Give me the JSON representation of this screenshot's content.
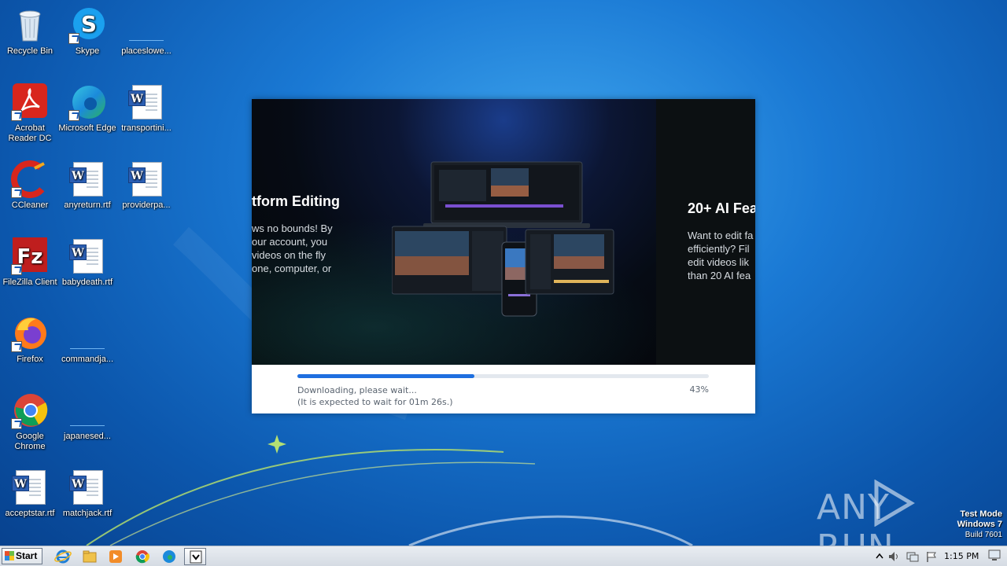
{
  "desktop": {
    "icons": [
      {
        "label": "Recycle Bin"
      },
      {
        "label": "Skype"
      },
      {
        "label": "placeslowe..."
      },
      {
        "label": "Acrobat\nReader DC"
      },
      {
        "label": "Microsoft Edge"
      },
      {
        "label": "transportini..."
      },
      {
        "label": "CCleaner"
      },
      {
        "label": "anyreturn.rtf"
      },
      {
        "label": "providerpa..."
      },
      {
        "label": "FileZilla Client"
      },
      {
        "label": "babydeath.rtf"
      },
      {
        "label": "Firefox"
      },
      {
        "label": "commandja..."
      },
      {
        "label": "Google\nChrome"
      },
      {
        "label": "japanesed..."
      },
      {
        "label": "acceptstar.rtf"
      },
      {
        "label": "matchjack.rtf"
      }
    ]
  },
  "installer": {
    "banner": {
      "left_title": "tform Editing",
      "left_text": "ws no bounds! By\nour account, you\nvideos on the fly\none, computer, or",
      "right_title": "20+ AI Fea",
      "right_text": "Want to edit fa\nefficiently? Fil\nedit videos lik\nthan 20 AI fea"
    },
    "progress": {
      "value": 0.43,
      "status": "Downloading, please wait...",
      "eta": "(It is expected to wait for 01m 26s.)",
      "percent_label": "43%"
    }
  },
  "watermark": {
    "text": "ANY RUN"
  },
  "test_mode": {
    "line1": "Test Mode",
    "line2": "Windows 7",
    "line3": "Build 7601"
  },
  "taskbar": {
    "start_label": "Start",
    "clock": "1:15 PM"
  }
}
